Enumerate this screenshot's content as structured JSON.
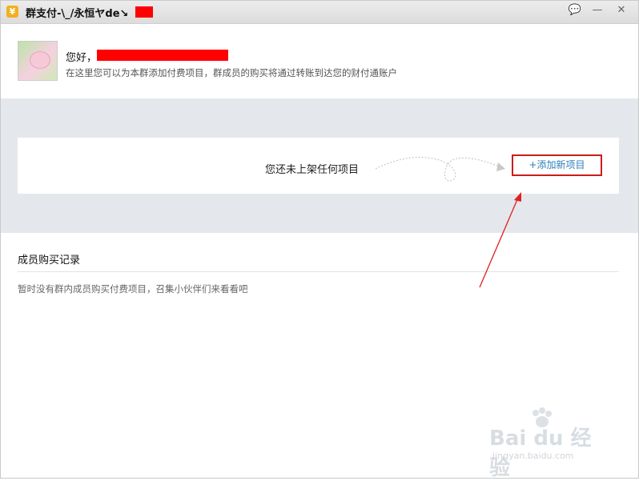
{
  "window": {
    "title": "群支付-\\_/永恒ヤde↘",
    "controls": {
      "chat": "💬",
      "minimize": "—",
      "close": "✕"
    }
  },
  "header": {
    "greeting": "您好，",
    "description": "在这里您可以为本群添加付费项目，群成员的购买将通过转账到达您的财付通账户"
  },
  "items": {
    "empty_text": "您还未上架任何项目",
    "add_button": "+添加新项目"
  },
  "records": {
    "title": "成员购买记录",
    "empty_text": "暂时没有群内成员购买付费项目，召集小伙伴们来看看吧"
  },
  "watermark": {
    "logo": "Bai du 经验",
    "sub": "jingyan.baidu.com"
  },
  "colors": {
    "accent": "#2f7fb8",
    "highlight": "#cc1b1b",
    "panel": "#e4e7eb"
  }
}
